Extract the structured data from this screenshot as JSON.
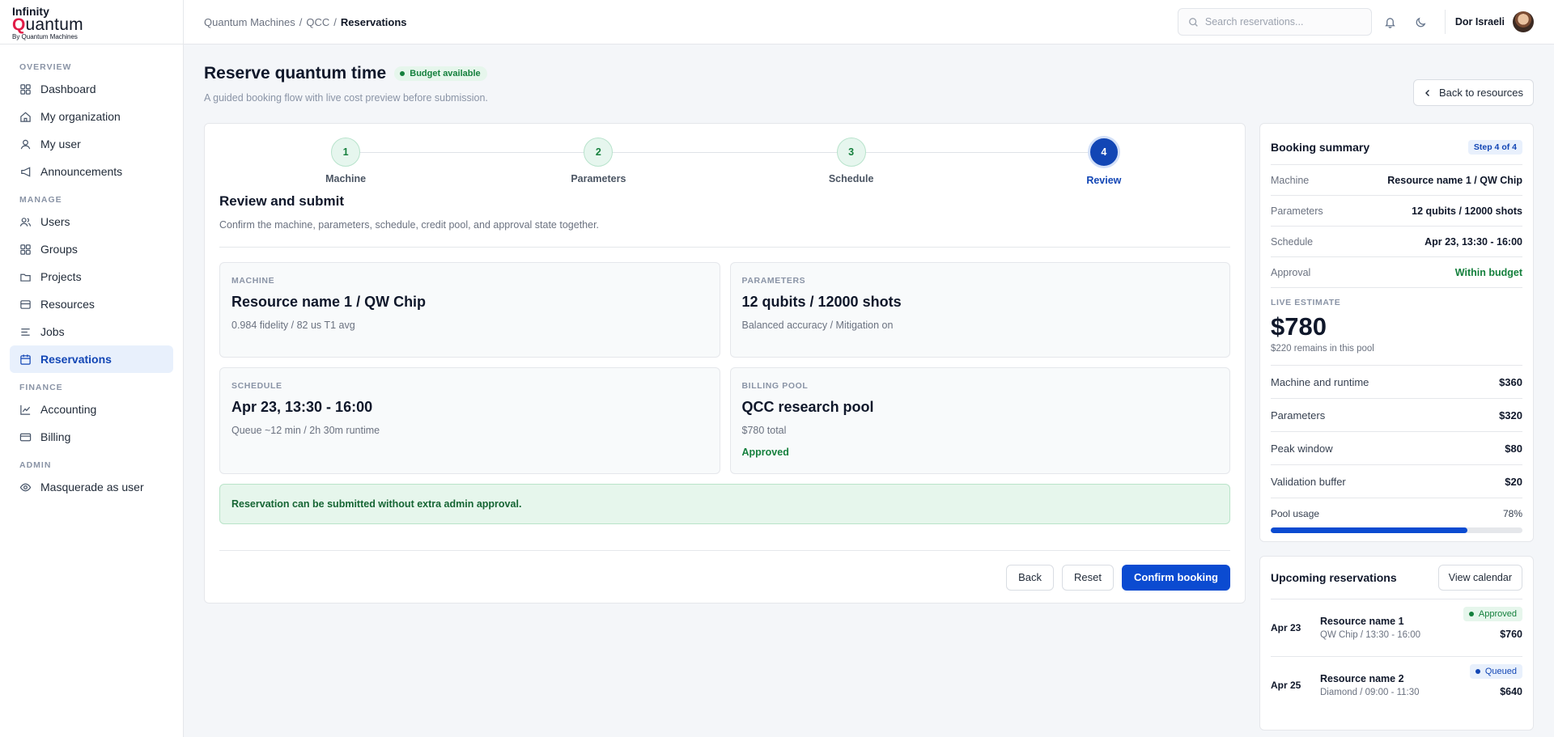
{
  "brand": {
    "line1": "Infinity",
    "line2_q": "Q",
    "line2_rest": "uantum",
    "line3": "By Quantum Machines"
  },
  "sidebar": {
    "sections": [
      {
        "title": "OVERVIEW",
        "items": [
          "Dashboard",
          "My organization",
          "My user",
          "Announcements"
        ]
      },
      {
        "title": "MANAGE",
        "items": [
          "Users",
          "Groups",
          "Projects",
          "Resources",
          "Jobs",
          "Reservations"
        ]
      },
      {
        "title": "FINANCE",
        "items": [
          "Accounting",
          "Billing"
        ]
      },
      {
        "title": "ADMIN",
        "items": [
          "Masquerade as user"
        ]
      }
    ],
    "active": "Reservations"
  },
  "topbar": {
    "crumbs": [
      "Quantum Machines",
      "QCC",
      "Reservations"
    ],
    "search_placeholder": "Search reservations...",
    "user_name": "Dor Israeli"
  },
  "page": {
    "title": "Reserve quantum time",
    "badge": "Budget available",
    "subtitle": "A guided booking flow with live cost preview before submission.",
    "back_button": "Back to resources"
  },
  "stepper": {
    "steps": [
      {
        "num": "1",
        "label": "Machine"
      },
      {
        "num": "2",
        "label": "Parameters"
      },
      {
        "num": "3",
        "label": "Schedule"
      },
      {
        "num": "4",
        "label": "Review"
      }
    ],
    "active_index": 3
  },
  "review": {
    "title": "Review and submit",
    "subtitle": "Confirm the machine, parameters, schedule, credit pool, and approval state together.",
    "machine": {
      "label": "MACHINE",
      "value": "Resource name 1 / QW Chip",
      "detail": "0.984 fidelity / 82 us T1 avg"
    },
    "parameters": {
      "label": "PARAMETERS",
      "value": "12 qubits / 12000 shots",
      "detail": "Balanced accuracy / Mitigation on"
    },
    "schedule": {
      "label": "SCHEDULE",
      "value": "Apr 23, 13:30 - 16:00",
      "detail": "Queue ~12 min / 2h 30m runtime"
    },
    "billing": {
      "label": "BILLING POOL",
      "value": "QCC research pool",
      "detail": "$780 total",
      "status": "Approved"
    },
    "notice": "Reservation can be submitted without extra admin approval.",
    "buttons": {
      "back": "Back",
      "reset": "Reset",
      "confirm": "Confirm booking"
    }
  },
  "summary": {
    "title": "Booking summary",
    "step_pill": "Step 4 of 4",
    "rows": [
      {
        "k": "Machine",
        "v": "Resource name 1 / QW Chip"
      },
      {
        "k": "Parameters",
        "v": "12 qubits / 12000 shots"
      },
      {
        "k": "Schedule",
        "v": "Apr 23, 13:30 - 16:00"
      },
      {
        "k": "Approval",
        "v": "Within budget"
      }
    ],
    "estimate_label": "LIVE ESTIMATE",
    "estimate_price": "$780",
    "estimate_remaining": "$220 remains in this pool",
    "costs": [
      {
        "k": "Machine and runtime",
        "v": "$360"
      },
      {
        "k": "Parameters",
        "v": "$320"
      },
      {
        "k": "Peak window",
        "v": "$80"
      },
      {
        "k": "Validation buffer",
        "v": "$20"
      }
    ],
    "pool_label": "Pool usage",
    "pool_pct_text": "78%",
    "pool_fraction": 0.78
  },
  "upcoming": {
    "title": "Upcoming reservations",
    "calendar_button": "View calendar",
    "items": [
      {
        "date": "Apr 23",
        "name": "Resource name 1",
        "detail": "QW Chip / 13:30 - 16:00",
        "status": "Approved",
        "amount": "$760"
      },
      {
        "date": "Apr 25",
        "name": "Resource name 2",
        "detail": "Diamond / 09:00 - 11:30",
        "status": "Queued",
        "amount": "$640"
      }
    ]
  },
  "colors": {
    "accent": "#0b4bd1",
    "success": "#15803d",
    "active_bg": "#e8f0fc"
  }
}
